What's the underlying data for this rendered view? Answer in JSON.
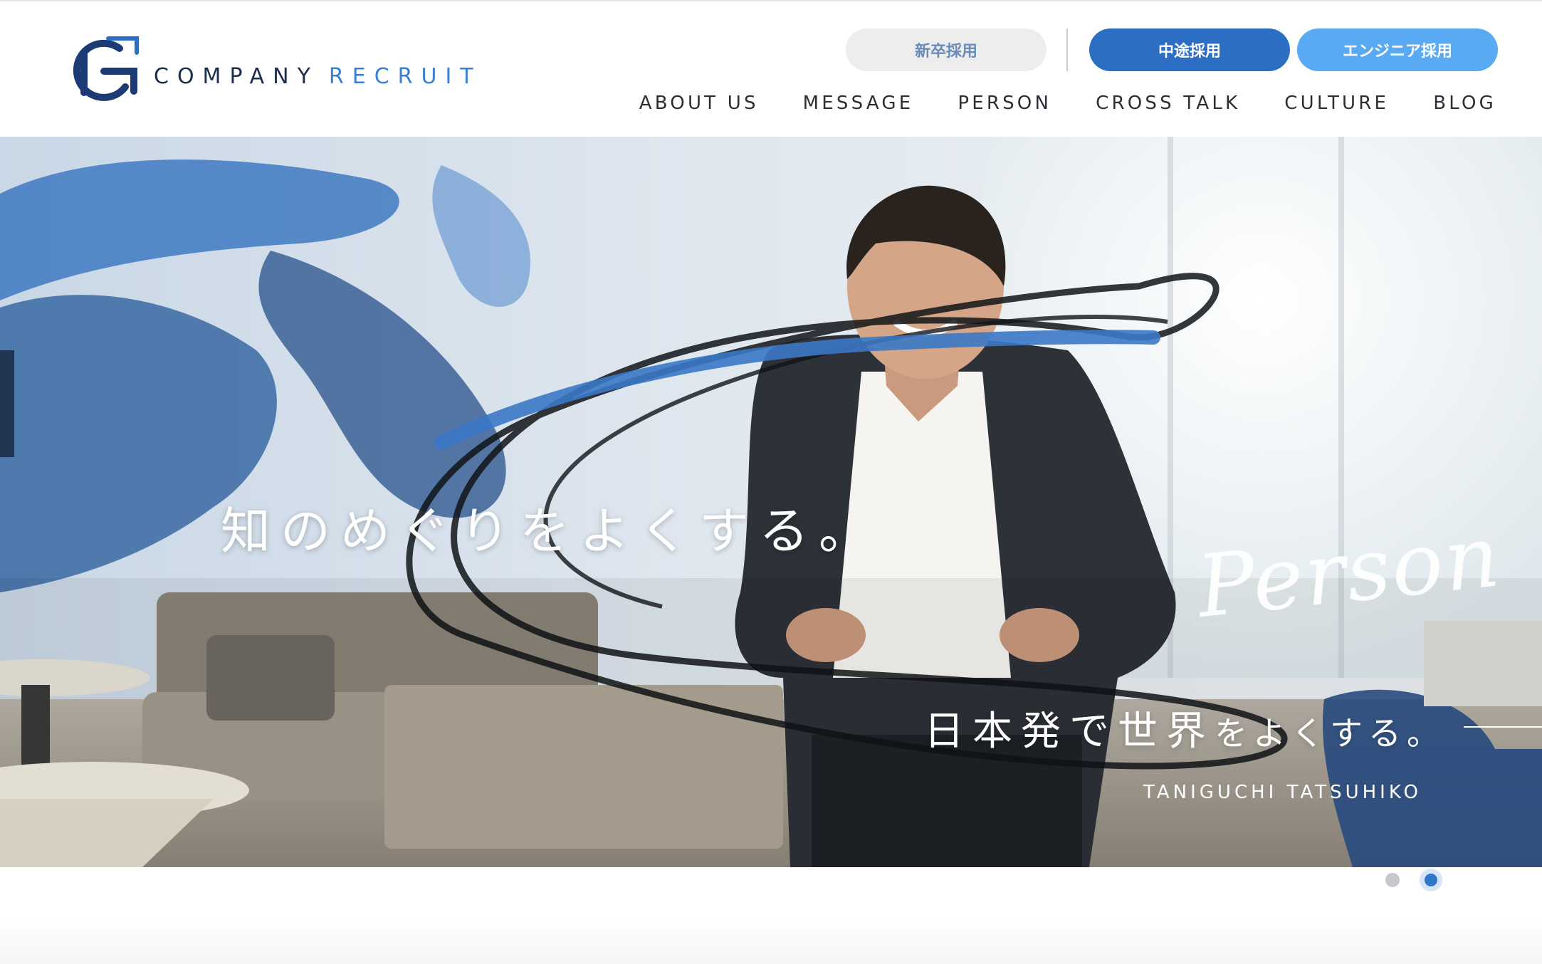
{
  "header": {
    "logo": {
      "word1": "COMPANY",
      "word2": "RECRUIT",
      "icon": "company-g-logo-icon"
    },
    "buttons": {
      "new_grad": "新卒採用",
      "mid_career": "中途採用",
      "engineer": "エンジニア採用"
    },
    "nav": [
      "ABOUT US",
      "MESSAGE",
      "PERSON",
      "CROSS TALK",
      "CULTURE",
      "BLOG"
    ]
  },
  "hero": {
    "tagline": "知のめぐりをよくする。",
    "script_title": "Person",
    "quote_main": "日本発で世界",
    "quote_tail": "をよくする。",
    "person_name": "TANIGUCHI TATSUHIKO"
  },
  "pager": {
    "total": 2,
    "active": 2
  },
  "colors": {
    "brand_navy": "#1c2e4e",
    "brand_blue": "#2d6ec5",
    "brand_light_blue": "#5aa9f3",
    "accent_text": "#3b7fd0"
  }
}
